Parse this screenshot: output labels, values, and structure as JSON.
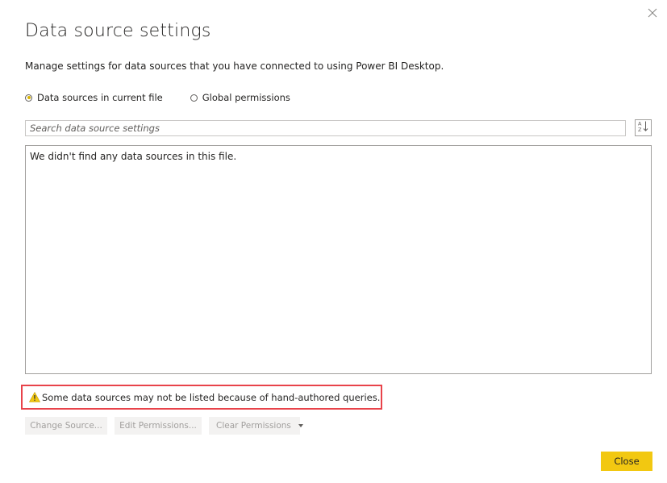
{
  "dialog": {
    "title": "Data source settings",
    "subtitle": "Manage settings for data sources that you have connected to using Power BI Desktop."
  },
  "scope": {
    "options": [
      {
        "label": "Data sources in current file",
        "selected": true
      },
      {
        "label": "Global permissions",
        "selected": false
      }
    ]
  },
  "search": {
    "placeholder": "Search data source settings",
    "value": ""
  },
  "sort_button": {
    "icon": "sort-az-icon"
  },
  "list": {
    "empty_message": "We didn't find any data sources in this file."
  },
  "warning": {
    "icon": "warning-icon",
    "text": "Some data sources may not be listed because of hand-authored queries."
  },
  "actions": {
    "change_source_label": "Change Source...",
    "edit_permissions_label": "Edit Permissions...",
    "clear_permissions_label": "Clear Permissions"
  },
  "footer": {
    "close_label": "Close"
  },
  "colors": {
    "accent_yellow": "#F2C811",
    "warning_border": "#E8434A",
    "disabled_text": "#A19F9D"
  }
}
